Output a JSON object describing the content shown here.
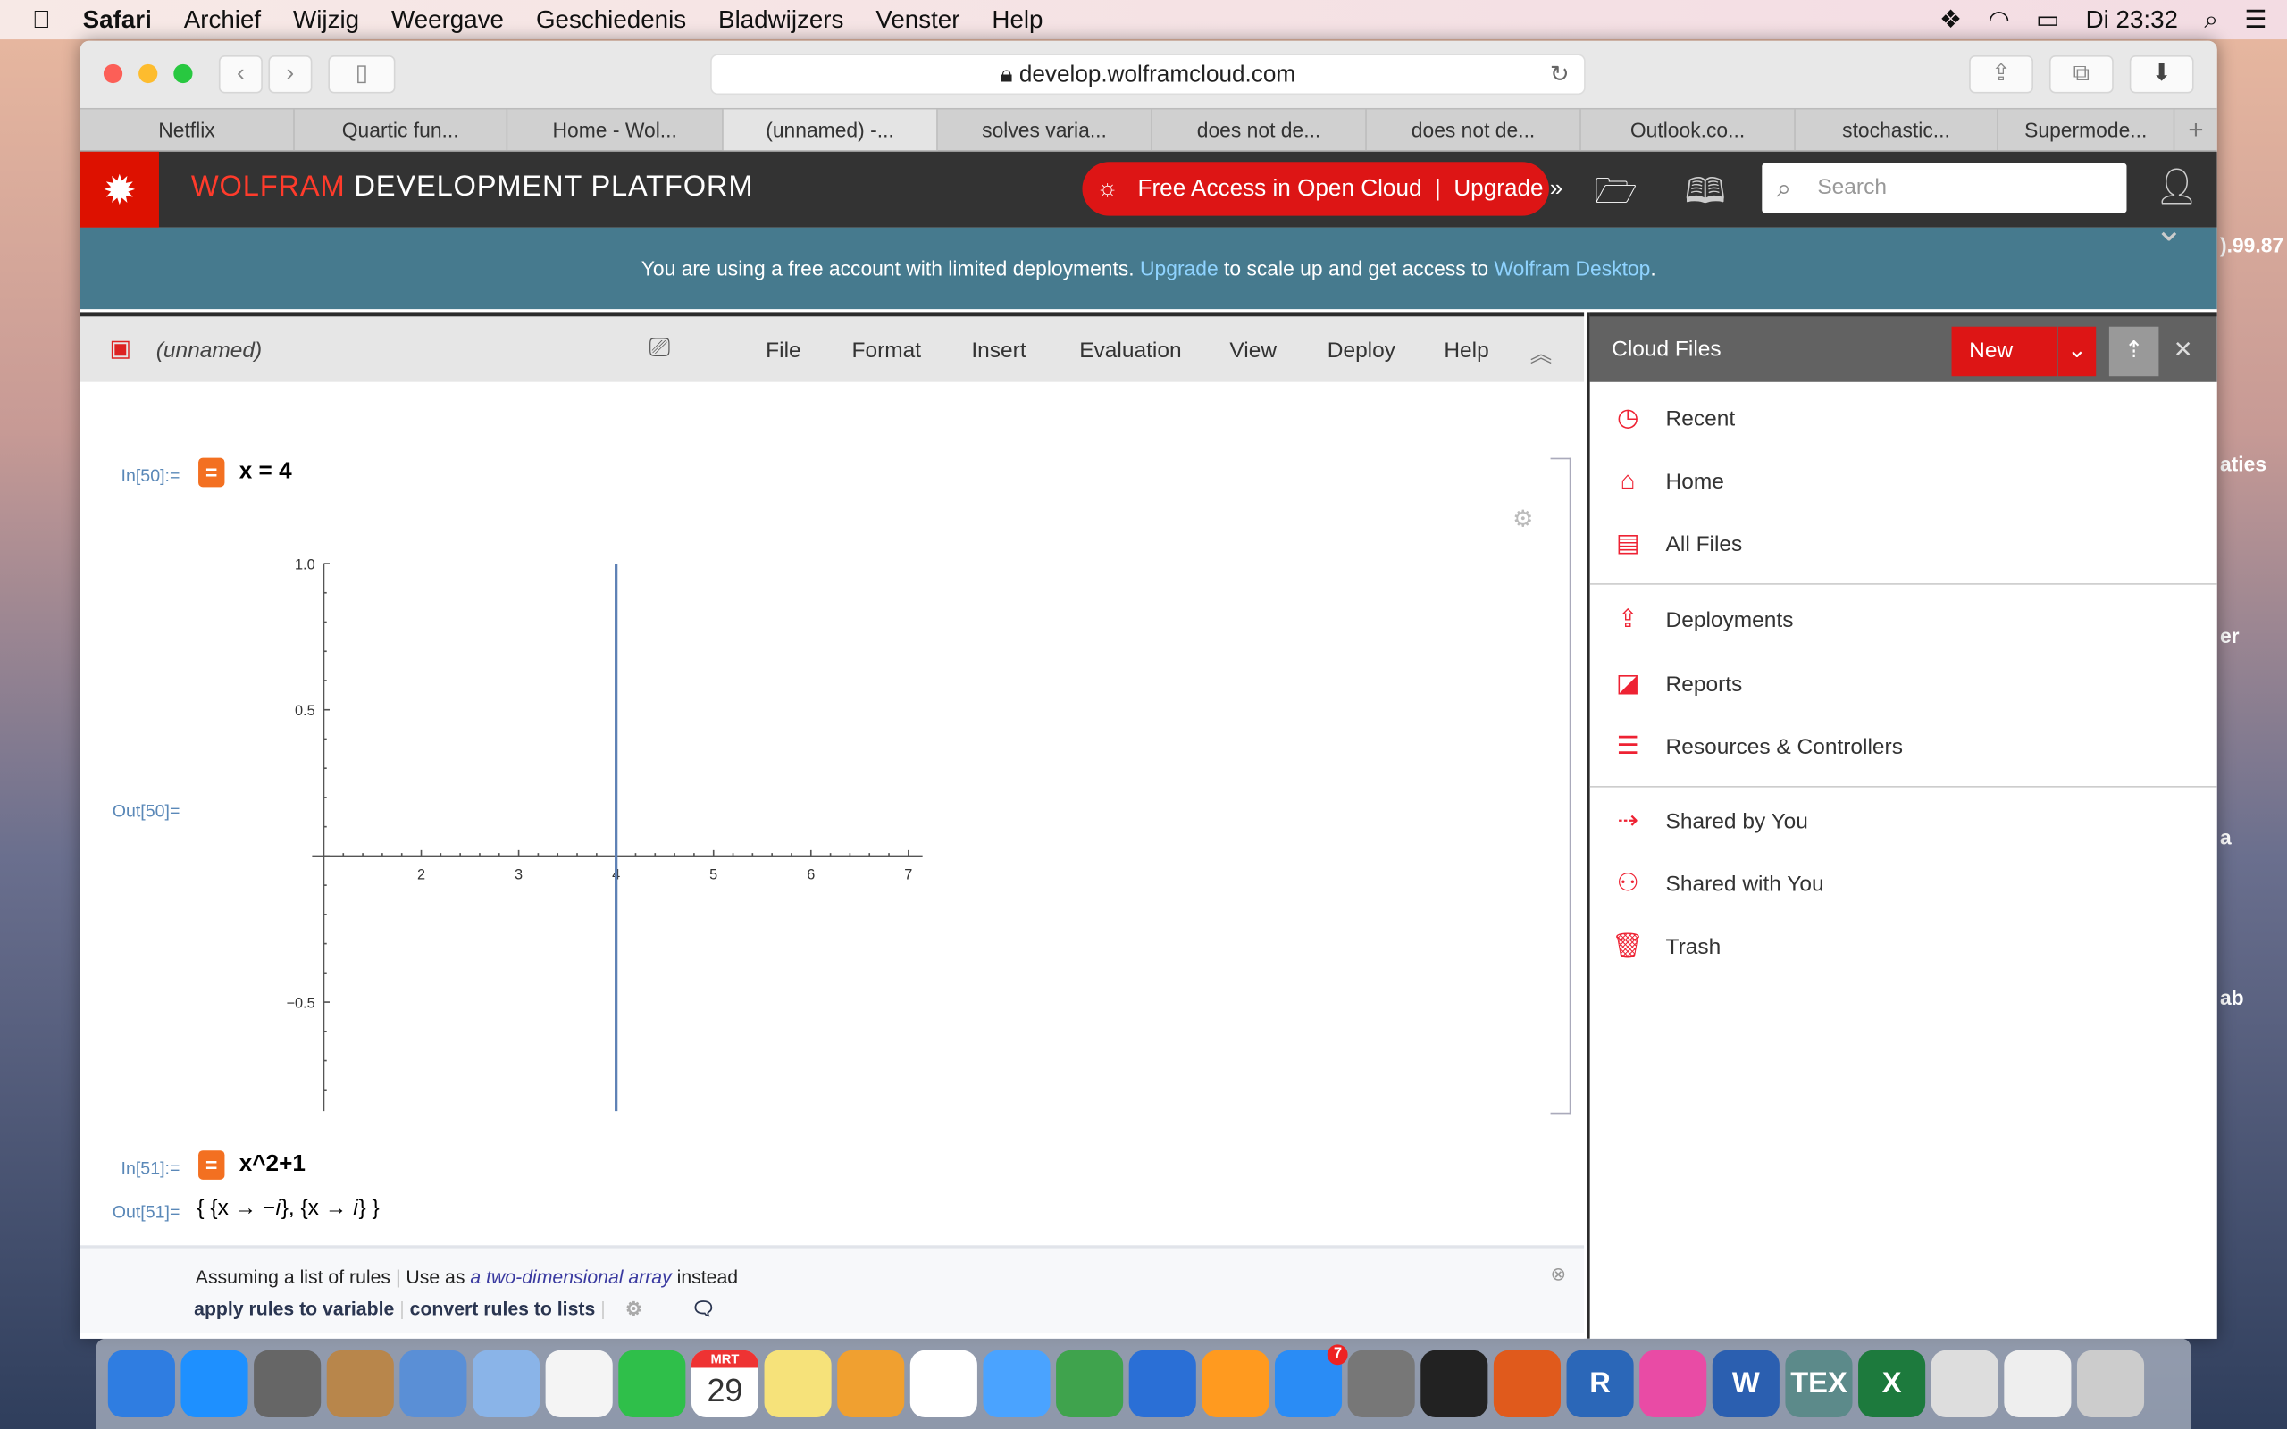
{
  "menubar": {
    "apple": "",
    "items": [
      "Safari",
      "Archief",
      "Wijzig",
      "Weergave",
      "Geschiedenis",
      "Bladwijzers",
      "Venster",
      "Help"
    ],
    "clock": "Di 23:32"
  },
  "browser": {
    "url": "develop.wolframcloud.com",
    "tabs": [
      "Netflix",
      "Quartic fun...",
      "Home - Wol...",
      "(unnamed) -...",
      "solves varia...",
      "does not de...",
      "does not de...",
      "Outlook.co...",
      "stochastic...",
      "Supermode..."
    ],
    "active_tab": 3,
    "new_tab": "+"
  },
  "header": {
    "brand_red": "WOLFRAM",
    "brand_white": "DEVELOPMENT PLATFORM",
    "free_access": "Free Access in Open Cloud",
    "upgrade": "Upgrade »",
    "search_placeholder": "Search"
  },
  "banner": {
    "text1": "You are using a free account with limited deployments.",
    "link1": "Upgrade",
    "text2": "to scale up and get access to",
    "link2": "Wolfram Desktop",
    "text3": "."
  },
  "notebook": {
    "title": "(unnamed)",
    "menu": [
      "File",
      "Format",
      "Insert",
      "Evaluation",
      "View",
      "Deploy",
      "Help"
    ],
    "cells": [
      {
        "in_label": "In[50]:=",
        "input": "x = 4",
        "out_label": "Out[50]="
      },
      {
        "in_label": "In[51]:=",
        "input": "x^2+1",
        "out_label": "Out[51]=",
        "output": "{ {x → −𝑖}, {x → 𝑖} }"
      }
    ],
    "assumption": {
      "prefix": "Assuming a list of rules",
      "use_as": "Use as",
      "alt": "a two-dimensional array",
      "suffix": "instead",
      "actions": [
        "apply rules to variable",
        "convert rules to lists"
      ]
    }
  },
  "chart_data": {
    "type": "line",
    "title": "",
    "xlabel": "",
    "ylabel": "",
    "xlim": [
      1,
      7.1
    ],
    "ylim": [
      -1,
      1
    ],
    "x_ticks": [
      "2",
      "3",
      "4",
      "5",
      "6",
      "7"
    ],
    "y_ticks": [
      "1.0",
      "0.5",
      "−0.5",
      "−1.0"
    ],
    "series": [
      {
        "x": [
          4,
          4
        ],
        "y": [
          -1,
          1
        ],
        "color": "#5e81b5"
      }
    ],
    "grid": false
  },
  "sidebar": {
    "title": "Cloud Files",
    "new_label": "New",
    "items": [
      {
        "label": "Recent",
        "icon": "clock-icon"
      },
      {
        "label": "Home",
        "icon": "home-icon"
      },
      {
        "label": "All Files",
        "icon": "file-icon"
      },
      {
        "label": "Deployments",
        "icon": "deploy-icon"
      },
      {
        "label": "Reports",
        "icon": "chart-icon"
      },
      {
        "label": "Resources & Controllers",
        "icon": "list-icon"
      },
      {
        "label": "Shared by You",
        "icon": "share-out-icon"
      },
      {
        "label": "Shared with You",
        "icon": "users-icon"
      },
      {
        "label": "Trash",
        "icon": "trash-icon"
      }
    ]
  },
  "desktop": {
    "labels": [
      ").99.87",
      "aties",
      "er",
      "a",
      "ab"
    ]
  },
  "dock": {
    "calendar_month": "MRT",
    "calendar_day": "29",
    "appstore_badge": "7",
    "apps": [
      "Finder",
      "Safari",
      "Launchpad",
      "Contacts",
      "Mail",
      "Preview",
      "Photos",
      "FaceTime",
      "Calendar",
      "Notes",
      "Pages",
      "Reminders",
      "Messages",
      "Numbers",
      "Keynote",
      "iBooks",
      "App Store",
      "System Preferences",
      "Activity Monitor",
      "MATLAB",
      "R",
      "iTunes",
      "Word",
      "TeX",
      "Excel",
      "Screenshot",
      "Preview2",
      "Trash"
    ]
  }
}
